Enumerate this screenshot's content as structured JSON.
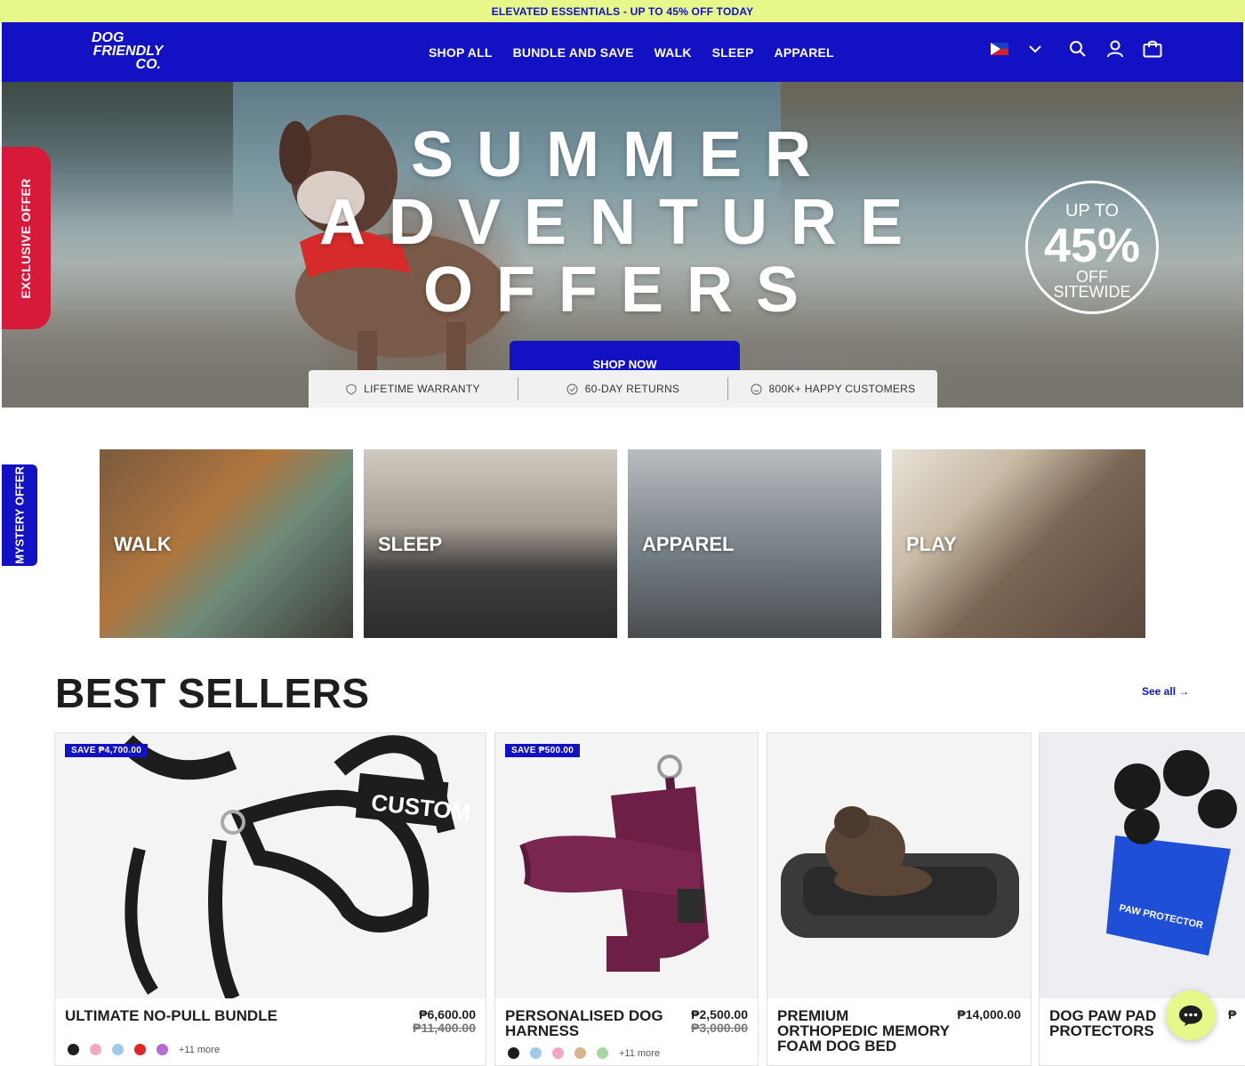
{
  "announcement": "ELEVATED ESSENTIALS - UP TO 45% OFF TODAY",
  "logo": {
    "line1": "DOG",
    "line2": "FRIENDLY",
    "line3": "CO."
  },
  "nav": [
    "SHOP ALL",
    "BUNDLE AND SAVE",
    "WALK",
    "SLEEP",
    "APPAREL"
  ],
  "header_icons": [
    "ph-flag-icon",
    "chevron-down-icon",
    "search-icon",
    "account-icon",
    "cart-icon"
  ],
  "hero": {
    "title_line1": "SUMMER",
    "title_line2": "ADVENTURE",
    "title_line3": "OFFERS",
    "badge_top": "UP TO",
    "badge_pct": "45%",
    "badge_line3": "OFF",
    "badge_line4": "SITEWIDE",
    "cta": "SHOP NOW"
  },
  "trust": [
    "LIFETIME WARRANTY",
    "60-DAY RETURNS",
    "800K+ HAPPY CUSTOMERS"
  ],
  "side_tabs": {
    "exclusive": "EXCLUSIVE OFFER",
    "mystery": "MYSTERY OFFER"
  },
  "categories": [
    "WALK",
    "SLEEP",
    "APPAREL",
    "PLAY"
  ],
  "best_sellers": {
    "title": "BEST SELLERS",
    "see_all": "See all →",
    "products": [
      {
        "save": "SAVE ₱4,700.00",
        "name": "ULTIMATE NO-PULL BUNDLE",
        "price": "₱6,600.00",
        "was": "₱11,400.00",
        "swatches": [
          "#1e1e1e",
          "#f2a8c4",
          "#9fc9e6",
          "#e02828",
          "#b46bd4"
        ],
        "more": "+11 more"
      },
      {
        "save": "SAVE ₱500.00",
        "name_l1": "PERSONALISED DOG",
        "name_l2": "HARNESS",
        "price": "₱2,500.00",
        "was": "₱3,000.00",
        "swatches": [
          "#1e1e1e",
          "#9fc9e6",
          "#f2a8c4",
          "#d9b48f",
          "#a8d6a0"
        ],
        "more": "+11 more"
      },
      {
        "name_l1": "PREMIUM",
        "name_l2": "ORTHOPEDIC MEMORY",
        "name_l3": "FOAM DOG BED",
        "price": "₱14,000.00"
      },
      {
        "name_l1": "DOG PAW PAD",
        "name_l2": "PROTECTORS",
        "price": "₱"
      }
    ]
  },
  "product_image_text": {
    "custom": "CUSTOM",
    "paw": "PAW PROTECTOR"
  },
  "colors": {
    "brand_blue": "#1212c4",
    "announce_bg": "#e8f78a",
    "exclusive_red": "#d81a3a"
  }
}
